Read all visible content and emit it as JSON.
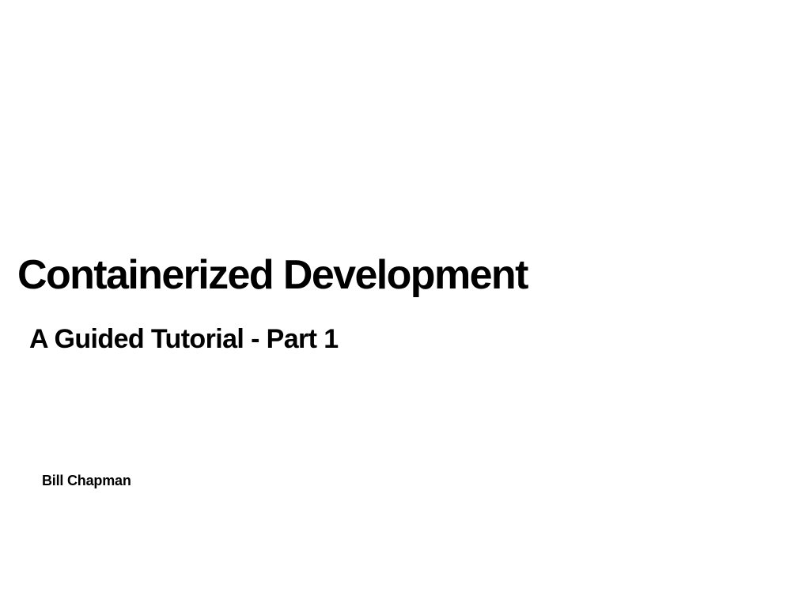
{
  "slide": {
    "title": "Containerized Development",
    "subtitle": "A Guided Tutorial - Part 1",
    "author": "Bill Chapman"
  }
}
